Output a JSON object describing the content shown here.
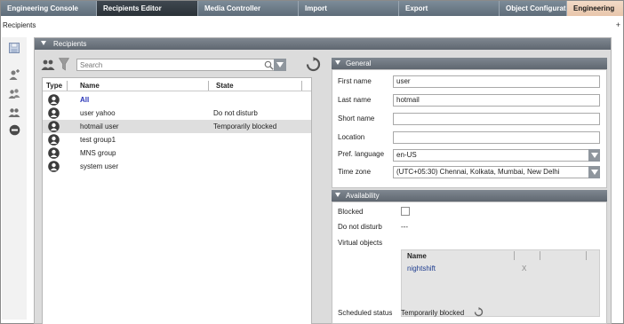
{
  "tabs": [
    {
      "label": "Engineering Console"
    },
    {
      "label": "Recipients Editor"
    },
    {
      "label": "Media Controller"
    },
    {
      "label": "Import"
    },
    {
      "label": "Export"
    },
    {
      "label": "Object Configurat"
    },
    {
      "label": "Engineering"
    }
  ],
  "breadcrumb": {
    "label": "Recipients",
    "close_glyph": "+"
  },
  "left_toolbar": {
    "icons": [
      "save-icon",
      "add-recipient-icon",
      "add-group-icon",
      "group-members-icon",
      "remove-icon"
    ]
  },
  "recipients": {
    "title": "Recipients",
    "search_placeholder": "Search",
    "columns": {
      "type": "Type",
      "name": "Name",
      "state": "State"
    },
    "rows": [
      {
        "name": "All",
        "state": ""
      },
      {
        "name": "user yahoo",
        "state": "Do not disturb"
      },
      {
        "name": "hotmail user",
        "state": "Temporarily blocked"
      },
      {
        "name": "test group1",
        "state": ""
      },
      {
        "name": "MNS group",
        "state": ""
      },
      {
        "name": "system user",
        "state": ""
      }
    ],
    "selected_row": 2
  },
  "general": {
    "title": "General",
    "first_name": {
      "label": "First name",
      "value": "user"
    },
    "last_name": {
      "label": "Last name",
      "value": "hotmail"
    },
    "short_name": {
      "label": "Short name",
      "value": ""
    },
    "location": {
      "label": "Location",
      "value": ""
    },
    "pref_language": {
      "label": "Pref. language",
      "value": "en-US"
    },
    "time_zone": {
      "label": "Time zone",
      "value": "(UTC+05:30) Chennai, Kolkata, Mumbai, New Delhi"
    }
  },
  "availability": {
    "title": "Availability",
    "blocked": {
      "label": "Blocked",
      "checked": false
    },
    "do_not_disturb": {
      "label": "Do not disturb",
      "value": "---"
    },
    "virtual_objects": {
      "label": "Virtual objects",
      "column": "Name",
      "rows": [
        {
          "name": "nightshift",
          "remove": "X"
        }
      ]
    },
    "scheduled_status": {
      "label": "Scheduled status",
      "value": "Temporarily blocked"
    }
  },
  "colors": {
    "accent_link": "#2a36b8",
    "header_gray": "#6f7780",
    "tab_active_light": "#ecceb6"
  }
}
